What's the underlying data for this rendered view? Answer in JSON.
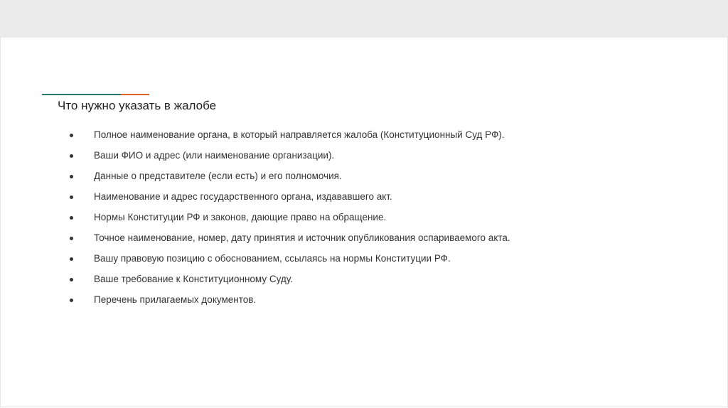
{
  "colors": {
    "accent_teal": "#1f7a6b",
    "accent_orange": "#e0632a"
  },
  "slide": {
    "title": "Что нужно указать в жалобе",
    "items": [
      "Полное наименование органа, в который направляется жалоба (Конституционный Суд РФ).",
      "Ваши ФИО и адрес (или наименование организации).",
      "Данные о представителе (если есть) и его полномочия.",
      "Наименование и адрес государственного органа, издававшего акт.",
      "Нормы Конституции РФ и законов, дающие право на обращение.",
      "Точное наименование, номер, дату принятия и источник опубликования оспариваемого акта.",
      "Вашу правовую позицию с обоснованием, ссылаясь на нормы Конституции РФ.",
      "Ваше требование к Конституционному Суду.",
      "Перечень прилагаемых документов."
    ]
  }
}
